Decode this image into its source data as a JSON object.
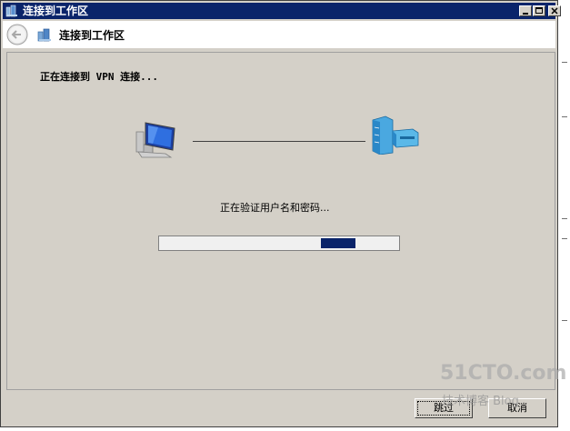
{
  "window": {
    "title": "连接到工作区"
  },
  "nav": {
    "title": "连接到工作区"
  },
  "content": {
    "heading": "正在连接到 VPN 连接...",
    "status": "正在验证用户名和密码...",
    "progress_fraction": 0.14
  },
  "buttons": {
    "skip": "跳过",
    "cancel": "取消"
  },
  "watermark": {
    "main": "51CTO.com",
    "sub": "技术博客  Blog"
  },
  "colors": {
    "titlebar": "#0a246a",
    "window_bg": "#d4d0c8",
    "progress_fill": "#0a246a"
  }
}
